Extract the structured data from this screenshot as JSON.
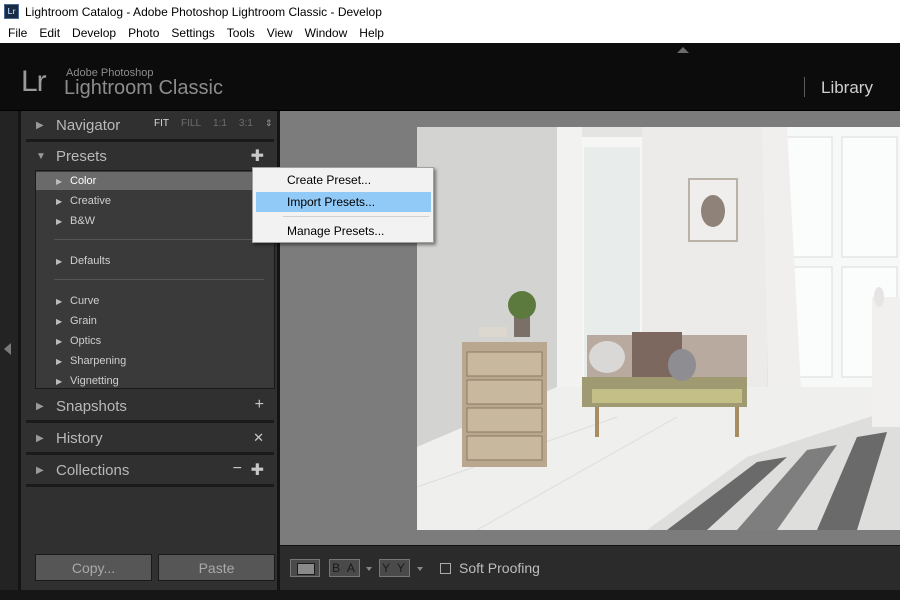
{
  "window": {
    "title": "Lightroom Catalog - Adobe Photoshop Lightroom Classic - Develop",
    "app_icon": "Lr"
  },
  "menubar": {
    "items": [
      "File",
      "Edit",
      "Develop",
      "Photo",
      "Settings",
      "Tools",
      "View",
      "Window",
      "Help"
    ]
  },
  "identity": {
    "mark": "Lr",
    "brand_top": "Adobe Photoshop",
    "brand_main": "Lightroom Classic",
    "module": "Library"
  },
  "left_panel": {
    "navigator": {
      "title": "Navigator",
      "zoom_options": [
        "FIT",
        "FILL",
        "1:1",
        "3:1"
      ],
      "zoom_selected": "FIT"
    },
    "presets": {
      "title": "Presets",
      "add_icon": "plus-icon",
      "groups_a": [
        "Color",
        "Creative",
        "B&W"
      ],
      "groups_b": [
        "Defaults"
      ],
      "groups_c": [
        "Curve",
        "Grain",
        "Optics",
        "Sharpening",
        "Vignetting"
      ],
      "selected": "Color"
    },
    "snapshots": {
      "title": "Snapshots",
      "icon": "plus-icon"
    },
    "history": {
      "title": "History",
      "icon": "close-icon"
    },
    "collections": {
      "title": "Collections",
      "icons": [
        "minus-icon",
        "plus-icon"
      ]
    },
    "buttons": {
      "copy": "Copy...",
      "paste": "Paste"
    }
  },
  "context_menu": {
    "items": [
      "Create Preset...",
      "Import Presets...",
      "Manage Presets..."
    ],
    "highlighted": "Import Presets..."
  },
  "toolbar": {
    "ba_label": "B A",
    "yy_label": "Y Y",
    "soft_proofing": "Soft Proofing",
    "soft_proofing_checked": false
  },
  "colors": {
    "panel_bg": "#303030",
    "menu_highlight": "#91c9f7",
    "image_bg": "#7c7c7c"
  }
}
